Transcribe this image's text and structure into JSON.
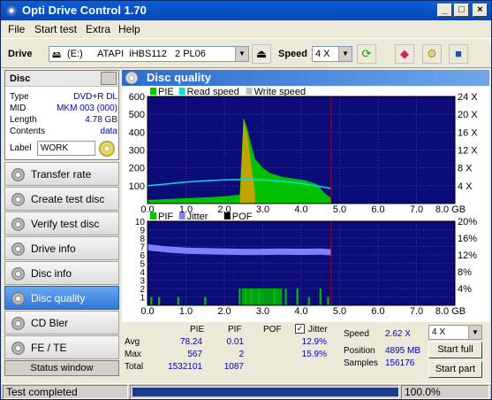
{
  "window": {
    "title": "Opti Drive Control 1.70"
  },
  "menu": [
    "File",
    "Start test",
    "Extra",
    "Help"
  ],
  "toolbar": {
    "drive_label": "Drive",
    "drive_letter": "(E:)",
    "drive_name": "ATAPI  iHBS112   2 PL06",
    "speed_label": "Speed",
    "speed_value": "4 X"
  },
  "disc": {
    "title": "Disc",
    "fields": [
      {
        "k": "Type",
        "v": "DVD+R DL"
      },
      {
        "k": "MID",
        "v": "MKM 003 (000)"
      },
      {
        "k": "Length",
        "v": "4.78 GB"
      },
      {
        "k": "Contents",
        "v": "data"
      }
    ],
    "label_key": "Label",
    "label_value": "WORK"
  },
  "nav": [
    {
      "label": "Transfer rate",
      "active": false
    },
    {
      "label": "Create test disc",
      "active": false
    },
    {
      "label": "Verify test disc",
      "active": false
    },
    {
      "label": "Drive info",
      "active": false
    },
    {
      "label": "Disc info",
      "active": false
    },
    {
      "label": "Disc quality",
      "active": true
    },
    {
      "label": "CD Bler",
      "active": false
    },
    {
      "label": "FE / TE",
      "active": false
    }
  ],
  "status_window_label": "Status window",
  "panel_title": "Disc quality",
  "chart_data": [
    {
      "type": "area",
      "legend": [
        "PIE",
        "Read speed",
        "Write speed"
      ],
      "legend_colors": [
        "#00c800",
        "#00e0e0",
        "#c0c0c0"
      ],
      "x_ticks": [
        "0.0",
        "1.0",
        "2.0",
        "3.0",
        "4.0",
        "5.0",
        "6.0",
        "7.0",
        "8.0 GB"
      ],
      "y_ticks_left": [
        "100",
        "200",
        "300",
        "400",
        "500",
        "600"
      ],
      "y_ticks_right": [
        "4 X",
        "8 X",
        "12 X",
        "16 X",
        "20 X",
        "24 X"
      ],
      "xlim": [
        0,
        8
      ],
      "ylim": [
        0,
        600
      ],
      "y2lim": [
        0,
        24
      ],
      "marker_x": 4.78,
      "pie_envelope": {
        "x": [
          0,
          0.5,
          1.0,
          1.5,
          2.0,
          2.4,
          2.5,
          2.6,
          2.7,
          2.8,
          3.0,
          3.2,
          3.5,
          3.8,
          4.1,
          4.4,
          4.6,
          4.78
        ],
        "y": [
          20,
          25,
          30,
          35,
          40,
          50,
          480,
          420,
          330,
          250,
          200,
          170,
          150,
          140,
          130,
          110,
          60,
          30
        ]
      },
      "read_speed": {
        "x": [
          0,
          0.5,
          1.0,
          1.5,
          2.0,
          2.5,
          3.0,
          3.5,
          4.0,
          4.5,
          4.78
        ],
        "y": [
          4.0,
          4.4,
          4.8,
          5.1,
          5.3,
          5.4,
          5.3,
          5.0,
          4.5,
          3.8,
          3.4
        ]
      }
    },
    {
      "type": "bar",
      "legend": [
        "PIF",
        "Jitter",
        "POF"
      ],
      "legend_colors": [
        "#00c800",
        "#8080ff",
        "#000000"
      ],
      "x_ticks": [
        "0.0",
        "1.0",
        "2.0",
        "3.0",
        "4.0",
        "5.0",
        "6.0",
        "7.0",
        "8.0 GB"
      ],
      "y_ticks_left": [
        "1",
        "2",
        "3",
        "4",
        "5",
        "6",
        "7",
        "8",
        "9",
        "10"
      ],
      "y_ticks_right": [
        "4%",
        "8%",
        "12%",
        "16%",
        "20%"
      ],
      "xlim": [
        0,
        8
      ],
      "ylim": [
        0,
        10
      ],
      "y2lim": [
        0,
        20
      ],
      "marker_x": 4.78,
      "jitter": {
        "x": [
          0,
          0.5,
          1.0,
          1.5,
          2.0,
          2.5,
          3.0,
          3.5,
          4.0,
          4.5,
          4.78
        ],
        "y": [
          13.8,
          13.3,
          13.0,
          12.9,
          12.8,
          12.7,
          12.7,
          12.8,
          12.7,
          12.8,
          12.6
        ]
      },
      "pif_spikes": {
        "x": [
          0.1,
          0.3,
          0.8,
          1.5,
          2.4,
          2.55,
          2.7,
          2.9,
          3.3,
          3.6,
          3.9,
          4.2,
          4.5,
          4.7
        ],
        "y": [
          1,
          1,
          1,
          1,
          2,
          2,
          2,
          2,
          2,
          2,
          2,
          1,
          2,
          1
        ]
      }
    }
  ],
  "stats": {
    "col_pie": "PIE",
    "col_pif": "PIF",
    "col_pof": "POF",
    "jitter_label": "Jitter",
    "avg_label": "Avg",
    "max_label": "Max",
    "total_label": "Total",
    "avg_pie": "78.24",
    "avg_pif": "0.01",
    "avg_jitter": "12.9%",
    "max_pie": "567",
    "max_pif": "2",
    "max_jitter": "15.9%",
    "total_pie": "1532101",
    "total_pif": "1087",
    "speed_label": "Speed",
    "speed_value": "2.62 X",
    "speed_select": "4 X",
    "position_label": "Position",
    "position_value": "4895 MB",
    "samples_label": "Samples",
    "samples_value": "156176",
    "start_full": "Start full",
    "start_part": "Start part"
  },
  "statusbar": {
    "text": "Test completed",
    "progress_text": "100.0%",
    "progress": 1.0
  }
}
